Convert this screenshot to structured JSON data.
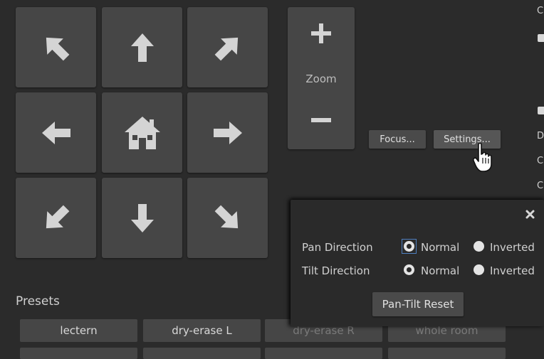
{
  "pan_tilt": {
    "buttons": [
      {
        "name": "pan-up-left-button",
        "icon": "arrow-up-left-icon",
        "rot": -45
      },
      {
        "name": "tilt-up-button",
        "icon": "arrow-up-icon",
        "rot": 0
      },
      {
        "name": "pan-up-right-button",
        "icon": "arrow-up-right-icon",
        "rot": 45
      },
      {
        "name": "pan-left-button",
        "icon": "arrow-left-icon",
        "rot": -90
      },
      {
        "name": "home-button",
        "icon": "home-icon",
        "rot": null
      },
      {
        "name": "pan-right-button",
        "icon": "arrow-right-icon",
        "rot": 90
      },
      {
        "name": "pan-down-left-button",
        "icon": "arrow-down-left-icon",
        "rot": -135
      },
      {
        "name": "tilt-down-button",
        "icon": "arrow-down-icon",
        "rot": 180
      },
      {
        "name": "pan-down-right-button",
        "icon": "arrow-down-right-icon",
        "rot": 135
      }
    ]
  },
  "zoom": {
    "label": "Zoom",
    "in_icon": "plus-icon",
    "out_icon": "minus-icon"
  },
  "toolbar": {
    "focus_label": "Focus...",
    "settings_label": "Settings..."
  },
  "right_edge": {
    "letters": [
      "C",
      "D",
      "C",
      "C"
    ]
  },
  "settings_popup": {
    "close_icon": "close-icon",
    "pan_direction": {
      "label": "Pan Direction",
      "options": [
        "Normal",
        "Inverted"
      ],
      "selected": "Normal"
    },
    "tilt_direction": {
      "label": "Tilt Direction",
      "options": [
        "Normal",
        "Inverted"
      ],
      "selected": "Normal"
    },
    "reset_label": "Pan-Tilt Reset"
  },
  "presets": {
    "heading": "Presets",
    "items": [
      "lectern",
      "dry-erase L",
      "dry-erase R",
      "whole room"
    ]
  },
  "colors": {
    "background": "#2b2b2b",
    "tile": "#464646",
    "focus_ring": "#4f7fbf"
  }
}
